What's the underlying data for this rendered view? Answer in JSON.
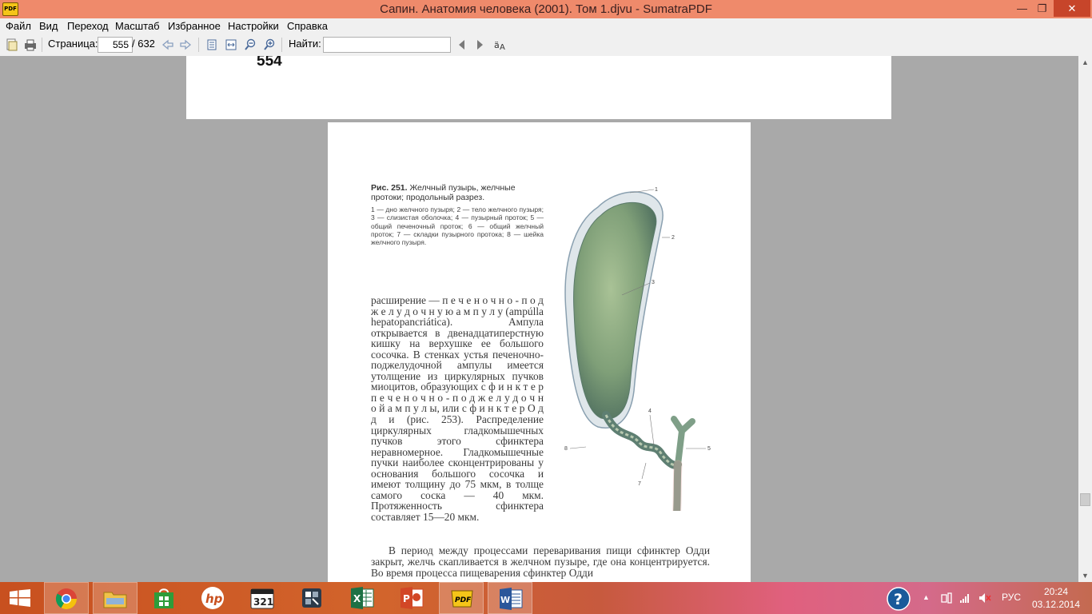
{
  "window": {
    "title": "Сапин. Анатомия человека (2001). Том 1.djvu - SumatraPDF",
    "app_icon": "sumatra-pdf-icon",
    "controls": {
      "minimize": "—",
      "maximize": "❐",
      "close": "✕"
    }
  },
  "menu": [
    "Файл",
    "Вид",
    "Переход",
    "Масштаб",
    "Избранное",
    "Настройки",
    "Справка"
  ],
  "toolbar": {
    "page_label": "Страница:",
    "page_value": "555",
    "page_total": "/ 632",
    "find_label": "Найти:",
    "find_value": ""
  },
  "document": {
    "prev_page_number": "554",
    "caption": {
      "fig_label": "Рис. 251.",
      "fig_title": " Желчный пузырь, желчные протоки; продольный разрез.",
      "legend": "1 — дно желчного пузыря; 2 — тело желчного пузыря; 3 — слизистая оболочка; 4 — пузырный проток; 5 — общий печеночный проток; 6 — общий желчный проток; 7 — складки пузырного протока; 8 — шейка желчного пузыря."
    },
    "body_column": "расширение — п е ч е н о ч н о - п о д ж е л у д о ч н у ю   а м п у л у (ampúlla hepatopancriática). Ампула открывается в двенадцатиперстную кишку на верхушке ее большого сосочка. В стенках устья печеночно-поджелудочной ампулы имеется утолщение из циркулярных пучков миоцитов, образующих с ф и н к т е р   п е ч е н о ч н о - п о д ж е л у д о ч н о й   а м п у л ы,   или   с ф и н к т е р О д д и (рис. 253). Распределение циркулярных гладкомышечных пучков этого сфинктера неравномерное. Гладкомышечные пучки наиболее сконцентрированы у основания большого сосочка и имеют толщину до 75 мкм, в толще самого соска — 40 мкм. Протяженность сфинктера составляет 15—20 мкм.",
    "body_wide": "В период между процессами переваривания пищи сфинктер Одди закрыт, желчь скапливается в желчном пузыре, где она концентрируется. Во время процесса пищеварения сфинктер Одди",
    "figure_labels": [
      "1",
      "2",
      "3",
      "4",
      "5",
      "6",
      "7",
      "8"
    ]
  },
  "taskbar": {
    "apps": [
      {
        "name": "start",
        "icon": "windows-logo-icon"
      },
      {
        "name": "chrome",
        "icon": "chrome-icon"
      },
      {
        "name": "file-explorer",
        "icon": "folder-icon"
      },
      {
        "name": "store",
        "icon": "store-icon"
      },
      {
        "name": "hp",
        "icon": "hp-logo-icon"
      },
      {
        "name": "media-player-classic",
        "icon": "mpc-321-icon"
      },
      {
        "name": "app",
        "icon": "app-tile-icon"
      },
      {
        "name": "excel",
        "icon": "excel-icon"
      },
      {
        "name": "powerpoint",
        "icon": "powerpoint-icon"
      },
      {
        "name": "sumatra",
        "icon": "pdf-icon"
      },
      {
        "name": "word",
        "icon": "word-icon"
      }
    ],
    "tray": {
      "language": "РУС",
      "time": "20:24",
      "date": "03.12.2014"
    }
  },
  "colors": {
    "titlebar": "#ef8a6b",
    "close_button": "#c7452a",
    "taskbar": "#d2642c",
    "viewport_bg": "#a9a9a9"
  }
}
